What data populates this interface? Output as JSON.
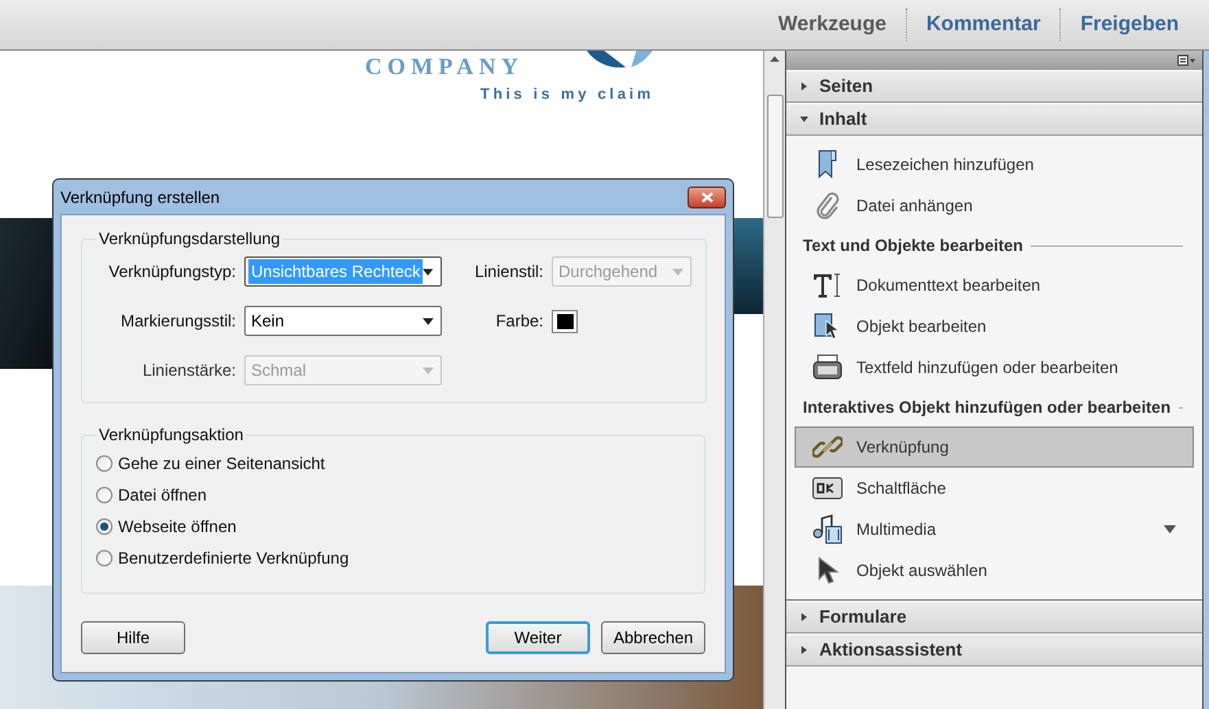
{
  "toolbar": {
    "tabs": [
      {
        "label": "Werkzeuge",
        "selected": true
      },
      {
        "label": "Kommentar",
        "selected": false
      },
      {
        "label": "Freigeben",
        "selected": false
      }
    ]
  },
  "document": {
    "company": "COMPANY",
    "claim": "This is my claim"
  },
  "dialog": {
    "title": "Verknüpfung erstellen",
    "appearance": {
      "title": "Verknüpfungsdarstellung",
      "link_type": {
        "label": "Verknüpfungstyp:",
        "value": "Unsichtbares Rechteck",
        "disabled": false,
        "focused": true
      },
      "line_style": {
        "label": "Linienstil:",
        "value": "Durchgehend",
        "disabled": true
      },
      "highlight_style": {
        "label": "Markierungsstil:",
        "value": "Kein",
        "disabled": false,
        "focused": false
      },
      "color": {
        "label": "Farbe:",
        "color": "#000000"
      },
      "line_width": {
        "label": "Linienstärke:",
        "value": "Schmal",
        "disabled": true
      }
    },
    "action": {
      "title": "Verknüpfungsaktion",
      "options": [
        {
          "label": "Gehe zu einer Seitenansicht",
          "selected": false
        },
        {
          "label": "Datei öffnen",
          "selected": false
        },
        {
          "label": "Webseite öffnen",
          "selected": true
        },
        {
          "label": "Benutzerdefinierte Verknüpfung",
          "selected": false
        }
      ]
    },
    "buttons": [
      {
        "label": "Hilfe",
        "kind": "help"
      },
      {
        "label": "Weiter",
        "kind": "default"
      },
      {
        "label": "Abbrechen",
        "kind": "normal"
      }
    ]
  },
  "panel": {
    "sections": [
      {
        "title": "Seiten",
        "expanded": false
      },
      {
        "title": "Inhalt",
        "expanded": true,
        "items": [
          {
            "label": "Lesezeichen hinzufügen",
            "selected": false,
            "has_menu": false
          },
          {
            "label": "Datei anhängen",
            "selected": false,
            "has_menu": false
          }
        ],
        "groups": [
          {
            "title": "Text und Objekte bearbeiten",
            "items": [
              {
                "label": "Dokumenttext bearbeiten",
                "selected": false,
                "has_menu": false
              },
              {
                "label": "Objekt bearbeiten",
                "selected": false,
                "has_menu": false
              },
              {
                "label": "Textfeld hinzufügen oder bearbeiten",
                "selected": false,
                "has_menu": false
              }
            ]
          },
          {
            "title": "Interaktives Objekt hinzufügen oder bearbeiten",
            "items": [
              {
                "label": "Verknüpfung",
                "selected": true,
                "has_menu": false
              },
              {
                "label": "Schaltfläche",
                "selected": false,
                "has_menu": false
              },
              {
                "label": "Multimedia",
                "selected": false,
                "has_menu": true
              },
              {
                "label": "Objekt auswählen",
                "selected": false,
                "has_menu": false
              }
            ]
          }
        ]
      },
      {
        "title": "Formulare",
        "expanded": false
      },
      {
        "title": "Aktionsassistent",
        "expanded": false
      }
    ]
  }
}
